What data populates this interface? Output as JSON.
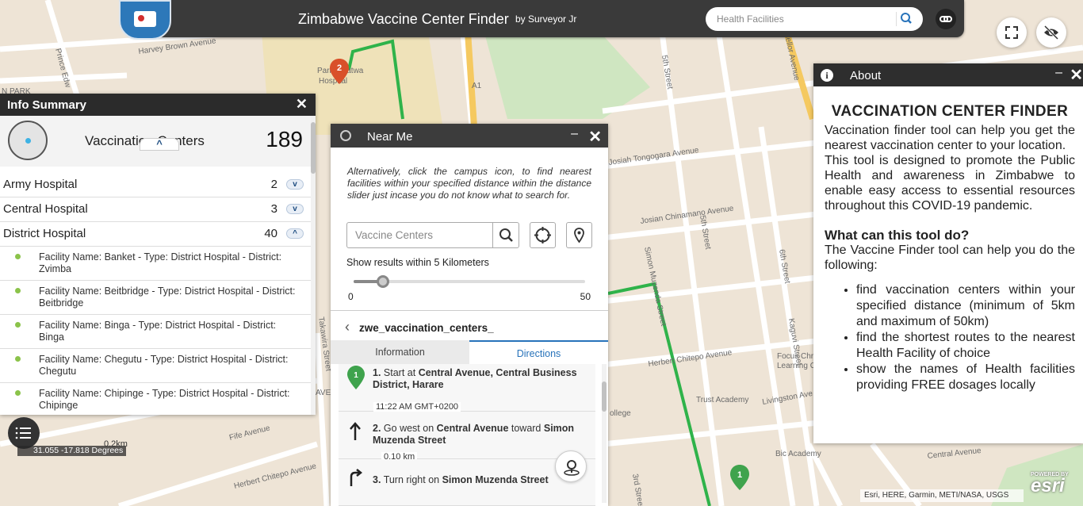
{
  "app": {
    "title": "Zimbabwe Vaccine Center Finder",
    "subtitle": "by Surveyor Jr",
    "search_placeholder": "Health Facilities",
    "accent": "#2873ba"
  },
  "map": {
    "street_labels": [
      "Harvey Brown Avenue",
      "Prince Edw",
      "N PARK",
      "Parirenyatwa",
      "Hospital",
      "5th Street",
      "Chancellor Avenue",
      "Josiah Tongogara Avenue",
      "Josian Chinamano Avenue",
      "Simon Muzenda Street",
      "5th Street",
      "6th Street",
      "6th Street",
      "Herbert Chitepo Avenue",
      "Trust Academy",
      "Livingston Ave",
      "Focus Chr",
      "Learning C",
      "Fife Avenue",
      "Herbert Chitepo Avenue",
      "3rd Street",
      "Bic Academy",
      "Central Avenue",
      "Kaguvi Street",
      "Takawira Street",
      "AVE",
      "ollege",
      "A1"
    ],
    "route_color": "#2fb34a",
    "pins": [
      {
        "label": "2",
        "color": "#d9502a"
      },
      {
        "label": "1",
        "color": "#3fa34d"
      }
    ],
    "coords": "31.055 -17.818 Degrees",
    "scale": "0.2km",
    "attribution": "Esri, HERE, Garmin, METI/NASA, USGS",
    "powered_by": "POWERED BY",
    "esri": "esri"
  },
  "info_summary": {
    "title": "Info Summary",
    "close": "✕",
    "summary_label": "Vaccination Centers",
    "summary_count": "189",
    "categories": [
      {
        "name": "Army Hospital",
        "count": "2",
        "expanded": false
      },
      {
        "name": "Central Hospital",
        "count": "3",
        "expanded": false
      },
      {
        "name": "District Hospital",
        "count": "40",
        "expanded": true
      }
    ],
    "facilities": [
      "Facility Name: Banket - Type: District Hospital - District: Zvimba",
      "Facility Name: Beitbridge - Type: District Hospital - District: Beitbridge",
      "Facility Name: Binga - Type: District Hospital - District: Binga",
      "Facility Name: Chegutu - Type: District Hospital - District: Chegutu",
      "Facility Name: Chipinge - Type: District Hospital - District: Chipinge"
    ]
  },
  "near_me": {
    "title": "Near Me",
    "minimize": "–",
    "close": "✕",
    "help": "Alternatively, click the campus icon, to find nearest facilities within your specified distance within the distance slider just incase you do not know what to search for.",
    "search_placeholder": "Vaccine Centers",
    "within_text": "Show results within 5 Kilometers",
    "slider": {
      "min": "0",
      "max": "50",
      "value": 5
    },
    "layer_name": "zwe_vaccination_centers_",
    "tabs": {
      "information": "Information",
      "directions": "Directions"
    },
    "steps": [
      {
        "num": "1.",
        "pre": "Start at ",
        "bold": "Central Avenue, Central Business District, Harare",
        "time": "11:22 AM GMT+0200"
      },
      {
        "num": "2.",
        "pre": "Go west on ",
        "bold1": "Central Avenue",
        "mid": " toward ",
        "bold2": "Simon Muzenda Street",
        "dist": "0.10 km"
      },
      {
        "num": "3.",
        "pre": "Turn right on ",
        "bold": "Simon Muzenda Street"
      }
    ]
  },
  "about": {
    "title": "About",
    "minimize": "–",
    "close": "✕",
    "heading": "VACCINATION CENTER FINDER",
    "para1": "Vaccination finder tool can help you get the nearest vaccination center to your location.",
    "para2": "This tool is designed to promote the Public Health and awareness in Zimbabwe to enable easy access to essential resources throughout this COVID-19 pandemic.",
    "subheading": "What can this tool do?",
    "para3": "The Vaccine Finder tool can help you do the following:",
    "bullets": [
      "find vaccination centers within your specified distance (minimum of 5km and maximum of 50km)",
      "find the shortest routes to the nearest Health Facility of choice",
      "show the names of Health facilities providing FREE dosages locally"
    ]
  }
}
